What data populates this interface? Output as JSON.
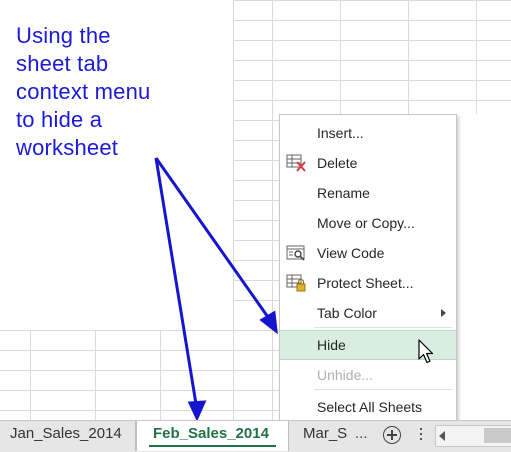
{
  "annotation": {
    "lines": [
      "Using the",
      "sheet tab",
      "context menu",
      "to hide a",
      "worksheet"
    ]
  },
  "context_menu": {
    "items": [
      {
        "label": "Insert...",
        "icon": null,
        "state": "normal"
      },
      {
        "label": "Delete",
        "icon": "delete-sheet-icon",
        "state": "normal"
      },
      {
        "label": "Rename",
        "icon": null,
        "state": "normal"
      },
      {
        "label": "Move or Copy...",
        "icon": null,
        "state": "normal"
      },
      {
        "label": "View Code",
        "icon": "view-code-icon",
        "state": "normal"
      },
      {
        "label": "Protect Sheet...",
        "icon": "protect-sheet-icon",
        "state": "normal"
      },
      {
        "label": "Tab Color",
        "icon": null,
        "state": "submenu"
      },
      {
        "label": "Hide",
        "icon": null,
        "state": "hover"
      },
      {
        "label": "Unhide...",
        "icon": null,
        "state": "disabled"
      },
      {
        "label": "Select All Sheets",
        "icon": null,
        "state": "normal"
      }
    ]
  },
  "sheet_tabs": {
    "tabs": [
      {
        "label": "Jan_Sales_2014",
        "active": false
      },
      {
        "label": "Feb_Sales_2014",
        "active": true
      },
      {
        "label": "Mar_S",
        "active": false
      }
    ],
    "overflow_label": "...",
    "add_sheet_icon": "plus-circle-icon",
    "options_icon": "vertical-dots-icon",
    "scroll_left_icon": "triangle-left-icon"
  },
  "colors": {
    "annotation": "#1a1ad8",
    "arrow": "#1515d0",
    "active_tab_text": "#217346",
    "menu_hover": "#d9ede0",
    "disabled_text": "#b0b0b0"
  }
}
